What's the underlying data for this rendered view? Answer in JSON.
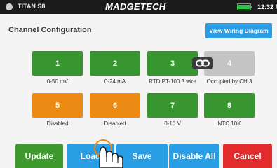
{
  "status_bar": {
    "device_name": "TITAN S8",
    "brand": "MADGETECH",
    "battery_level": 1.0,
    "time": "12:32 P"
  },
  "page": {
    "title": "Channel Configuration",
    "wiring_button": "View Wiring Diagram"
  },
  "channels": [
    {
      "number": "1",
      "label": "0-50 mV",
      "state": "green"
    },
    {
      "number": "2",
      "label": "0-24 mA",
      "state": "green"
    },
    {
      "number": "3",
      "label": "RTD PT-100 3 wire",
      "state": "green"
    },
    {
      "number": "4",
      "label": "Occupied by CH 3",
      "state": "gray"
    },
    {
      "number": "5",
      "label": "Disabled",
      "state": "orange"
    },
    {
      "number": "6",
      "label": "Disabled",
      "state": "orange"
    },
    {
      "number": "7",
      "label": "0-10 V",
      "state": "green"
    },
    {
      "number": "8",
      "label": "NTC 10K",
      "state": "green"
    }
  ],
  "link_icon": "chain-link-icon",
  "actions": {
    "update": "Update",
    "load": "Load",
    "save": "Save",
    "disable_all": "Disable All",
    "cancel": "Cancel"
  },
  "colors": {
    "green": "#37962f",
    "orange": "#ec8b13",
    "gray": "#c4c4c4",
    "blue": "#2a9ee4",
    "red": "#e22b2d"
  }
}
